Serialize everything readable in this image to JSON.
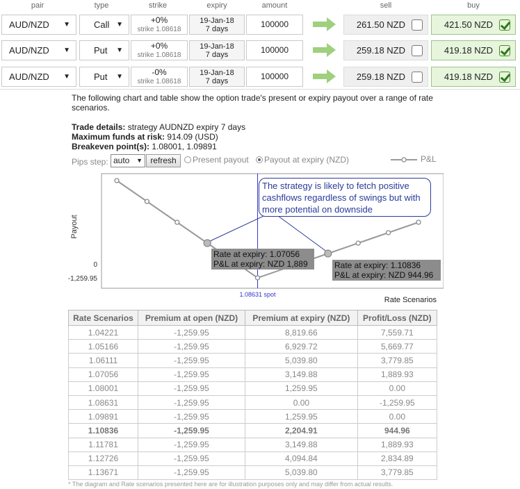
{
  "header": {
    "pair": "pair",
    "type": "type",
    "strike": "strike",
    "expiry": "expiry",
    "amount": "amount",
    "sell": "sell",
    "buy": "buy"
  },
  "rows": [
    {
      "pair": "AUD/NZD",
      "type": "Call",
      "strike": "+0%",
      "strike_sub": "strike 1.08618",
      "expiry_date": "19-Jan-18",
      "expiry_days": "7 days",
      "amount": "100000",
      "sell": "261.50 NZD",
      "buy": "421.50 NZD",
      "sell_checked": false,
      "buy_checked": true
    },
    {
      "pair": "AUD/NZD",
      "type": "Put",
      "strike": "+0%",
      "strike_sub": "strike 1.08618",
      "expiry_date": "19-Jan-18",
      "expiry_days": "7 days",
      "amount": "100000",
      "sell": "259.18 NZD",
      "buy": "419.18 NZD",
      "sell_checked": false,
      "buy_checked": true
    },
    {
      "pair": "AUD/NZD",
      "type": "Put",
      "strike": "-0%",
      "strike_sub": "strike 1.08618",
      "expiry_date": "19-Jan-18",
      "expiry_days": "7 days",
      "amount": "100000",
      "sell": "259.18 NZD",
      "buy": "419.18 NZD",
      "sell_checked": false,
      "buy_checked": true
    }
  ],
  "info": {
    "intro": "The following chart and table show the option trade's present or expiry payout over a range of rate scenarios.",
    "trade_label": "Trade details:",
    "trade_value": "strategy AUDNZD expiry 7 days",
    "risk_label": "Maximum funds at risk:",
    "risk_value": "914.09 (USD)",
    "breakeven_label": "Breakeven point(s):",
    "breakeven_value": "1.08001, 1.09891"
  },
  "controls": {
    "pips_label": "Pips step:",
    "pips_value": "auto",
    "refresh_label": "refresh",
    "present_label": "Present payout",
    "expiry_label": "Payout at expiry (NZD)",
    "present_selected": false,
    "expiry_selected": true,
    "legend_label": "P&L"
  },
  "chart_data": {
    "type": "line",
    "xlabel": "Rate Scenarios",
    "ylabel": "Payout",
    "spot_label": "1.08631 spot",
    "spot": 1.08631,
    "y_ticks": [
      "0",
      "-1,259.95"
    ],
    "series": [
      {
        "name": "P&L",
        "x": [
          1.04221,
          1.05166,
          1.06111,
          1.07056,
          1.08001,
          1.08631,
          1.09891,
          1.10836,
          1.11781,
          1.12726,
          1.13671
        ],
        "values": [
          7559.71,
          5669.77,
          3779.85,
          1889.93,
          0.0,
          -1259.95,
          0.0,
          944.96,
          1889.93,
          2834.89,
          3779.85
        ]
      }
    ],
    "callout": "The strategy is likely to fetch positive cashflows regardless of swings but with more potential on downside",
    "tip_left": [
      "Rate at expiry: 1.07056",
      "P&L at expiry: NZD 1,889"
    ],
    "tip_right": [
      "Rate at expiry: 1.10836",
      "P&L at expiry: NZD 944.96"
    ]
  },
  "table": {
    "columns": [
      "Rate Scenarios",
      "Premium at open (NZD)",
      "Premium at expiry (NZD)",
      "Profit/Loss (NZD)"
    ],
    "rows": [
      [
        "1.04221",
        "-1,259.95",
        "8,819.66",
        "7,559.71"
      ],
      [
        "1.05166",
        "-1,259.95",
        "6,929.72",
        "5,669.77"
      ],
      [
        "1.06111",
        "-1,259.95",
        "5,039.80",
        "3,779.85"
      ],
      [
        "1.07056",
        "-1,259.95",
        "3,149.88",
        "1,889.93"
      ],
      [
        "1.08001",
        "-1,259.95",
        "1,259.95",
        "0.00"
      ],
      [
        "1.08631",
        "-1,259.95",
        "0.00",
        "-1,259.95"
      ],
      [
        "1.09891",
        "-1,259.95",
        "1,259.95",
        "0.00"
      ],
      [
        "1.10836",
        "-1,259.95",
        "2,204.91",
        "944.96"
      ],
      [
        "1.11781",
        "-1,259.95",
        "3,149.88",
        "1,889.93"
      ],
      [
        "1.12726",
        "-1,259.95",
        "4,094.84",
        "2,834.89"
      ],
      [
        "1.13671",
        "-1,259.95",
        "5,039.80",
        "3,779.85"
      ]
    ],
    "highlight_row": 7
  },
  "disclaimer": "* The diagram and Rate scenarios presented here are for illustration purposes only and may differ from actual results.",
  "colors": {
    "buy_bg": "#e6f5dc",
    "arrow": "#9fcf7f",
    "callout": "#2a3a9a",
    "spot_line": "#3333cc",
    "series": "#9a9a9a"
  }
}
